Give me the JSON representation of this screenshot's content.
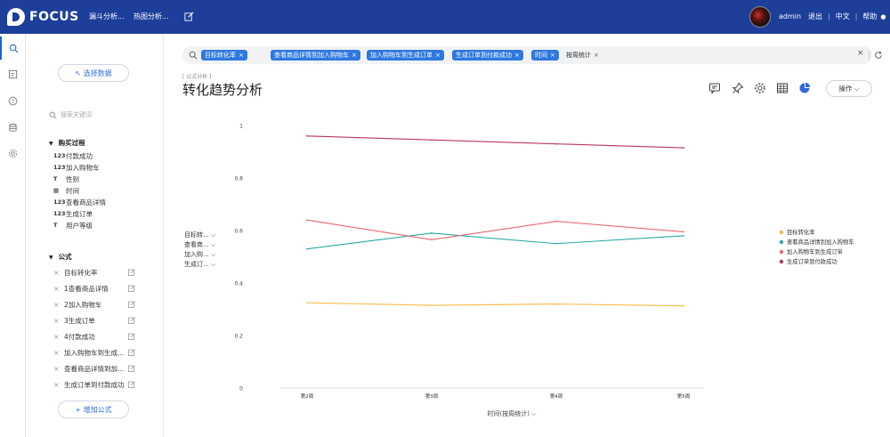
{
  "app": {
    "logo_text": "FOCUS",
    "nav": [
      "漏斗分析...",
      "热图分析..."
    ],
    "user": "admin",
    "links": [
      "退出",
      "中文",
      "帮助"
    ],
    "link_sep": "|"
  },
  "panel": {
    "select_data": "↖ 选择数据",
    "search_placeholder": "搜索关键词",
    "group1": {
      "title": "购买过程",
      "items": [
        {
          "type": "123",
          "label": "付款成功"
        },
        {
          "type": "123",
          "label": "加入购物车"
        },
        {
          "type": "T",
          "label": "性别"
        },
        {
          "type": "▦",
          "label": "时间"
        },
        {
          "type": "123",
          "label": "查看商品详情"
        },
        {
          "type": "123",
          "label": "生成订单"
        },
        {
          "type": "T",
          "label": "用户等级"
        }
      ]
    },
    "group2": {
      "title": "公式",
      "items": [
        "目标转化率",
        "1查看商品详情",
        "2加入购物车",
        "3生成订单",
        "4付款成功",
        "加入购物车到生成...",
        "查看商品详情到加...",
        "生成订单到付款成功"
      ]
    },
    "add_formula": "+ 增加公式"
  },
  "searchbar": {
    "chips": [
      {
        "label": "目标转化率",
        "style": "blue"
      },
      {
        "label": "查看商品详情到加入购物车",
        "style": "blue"
      },
      {
        "label": "加入购物车到生成订单",
        "style": "blue"
      },
      {
        "label": "生成订单到付款成功",
        "style": "blue"
      },
      {
        "label": "时间",
        "style": "blue"
      },
      {
        "label": "按周统计",
        "style": "plain"
      }
    ],
    "chip_close": "×",
    "clear": "×"
  },
  "main": {
    "breadcrumb": "[ 公式分析 ]",
    "title": "转化趋势分析",
    "op_button": "操作 ⌵"
  },
  "chart_data": {
    "type": "line",
    "categories": [
      "第2周",
      "第3周",
      "第4周",
      "第5周"
    ],
    "ylim": [
      0,
      1
    ],
    "yticks": [
      "0",
      "0.2",
      "0.4",
      "0.6",
      "0.8",
      "1"
    ],
    "xlabel": "时间(按周统计) ⌵",
    "y_legend": [
      "目标转... ⌵",
      "查看商... ⌵",
      "加入购... ⌵",
      "生成订... ⌵"
    ],
    "series": [
      {
        "name": "目标转化率",
        "color": "#f5b843",
        "values": [
          0.325,
          0.315,
          0.32,
          0.313
        ]
      },
      {
        "name": "查看商品详情到加入购物车",
        "color": "#27a9a6",
        "values": [
          0.53,
          0.59,
          0.55,
          0.58
        ]
      },
      {
        "name": "加入购物车到生成订单",
        "color": "#e8656d",
        "values": [
          0.64,
          0.565,
          0.635,
          0.595
        ]
      },
      {
        "name": "生成订单到付款成功",
        "color": "#b83466",
        "values": [
          0.96,
          0.945,
          0.93,
          0.915
        ]
      }
    ]
  }
}
